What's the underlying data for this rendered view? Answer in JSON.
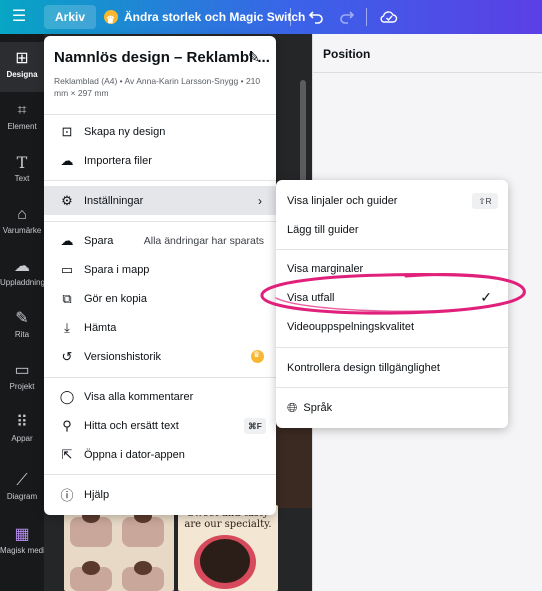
{
  "topbar": {
    "file_label": "Arkiv",
    "magic_label": "Ändra storlek och Magic Switch",
    "undo_icon": "undo-icon",
    "redo_icon": "redo-icon",
    "cloud_icon": "cloud-sync-icon"
  },
  "rail": {
    "items": [
      {
        "label": "Designa",
        "icon": "layout-icon"
      },
      {
        "label": "Element",
        "icon": "shapes-icon"
      },
      {
        "label": "Text",
        "icon": "text-icon"
      },
      {
        "label": "Varumärke",
        "icon": "brand-icon"
      },
      {
        "label": "Uppladdningar",
        "icon": "upload-cloud-icon"
      },
      {
        "label": "Rita",
        "icon": "draw-icon"
      },
      {
        "label": "Projekt",
        "icon": "folder-icon"
      },
      {
        "label": "Appar",
        "icon": "apps-grid-icon"
      },
      {
        "label": "Diagram",
        "icon": "chart-icon"
      },
      {
        "label": "Magisk media",
        "icon": "magic-media-icon"
      }
    ]
  },
  "position_panel": {
    "title": "Position"
  },
  "thumbnail": {
    "sweet_text": "Sweet and tasty are our specialty."
  },
  "file_menu": {
    "title": "Namnlös design – Reklambl ...",
    "subtitle": "Reklamblad (A4) • Av Anna-Karin Larsson-Snygg • 210 mm × 297 mm",
    "items": [
      {
        "label": "Skapa ny design",
        "icon": "new-design-icon"
      },
      {
        "label": "Importera filer",
        "icon": "upload-cloud-icon"
      },
      {
        "label": "Inställningar",
        "icon": "gear-icon"
      },
      {
        "label": "Spara",
        "icon": "cloud-check-icon",
        "extra": "Alla ändringar har sparats"
      },
      {
        "label": "Spara i mapp",
        "icon": "folder-icon"
      },
      {
        "label": "Gör en kopia",
        "icon": "copy-icon"
      },
      {
        "label": "Hämta",
        "icon": "download-icon"
      },
      {
        "label": "Versionshistorik",
        "icon": "history-icon"
      },
      {
        "label": "Visa alla kommentarer",
        "icon": "comment-icon"
      },
      {
        "label": "Hitta och ersätt text",
        "icon": "search-icon",
        "shortcut": "⌘F"
      },
      {
        "label": "Öppna i dator-appen",
        "icon": "external-link-icon"
      },
      {
        "label": "Hjälp",
        "icon": "help-icon"
      }
    ]
  },
  "settings_submenu": {
    "items": [
      {
        "label": "Visa linjaler och guider",
        "shortcut": "⇧R"
      },
      {
        "label": "Lägg till guider"
      },
      {
        "label": "Visa marginaler"
      },
      {
        "label": "Visa utfall",
        "checked": true
      },
      {
        "label": "Videouppspelningskvalitet"
      },
      {
        "label": "Kontrollera design tillgänglighet"
      },
      {
        "label": "Språk",
        "icon": "globe-icon"
      }
    ]
  },
  "colors": {
    "topbar_start": "#07a6c4",
    "topbar_end": "#5b3fe6",
    "rail": "#18191b",
    "annotation": "#e0207a",
    "premium_crown": "#f7b731"
  }
}
